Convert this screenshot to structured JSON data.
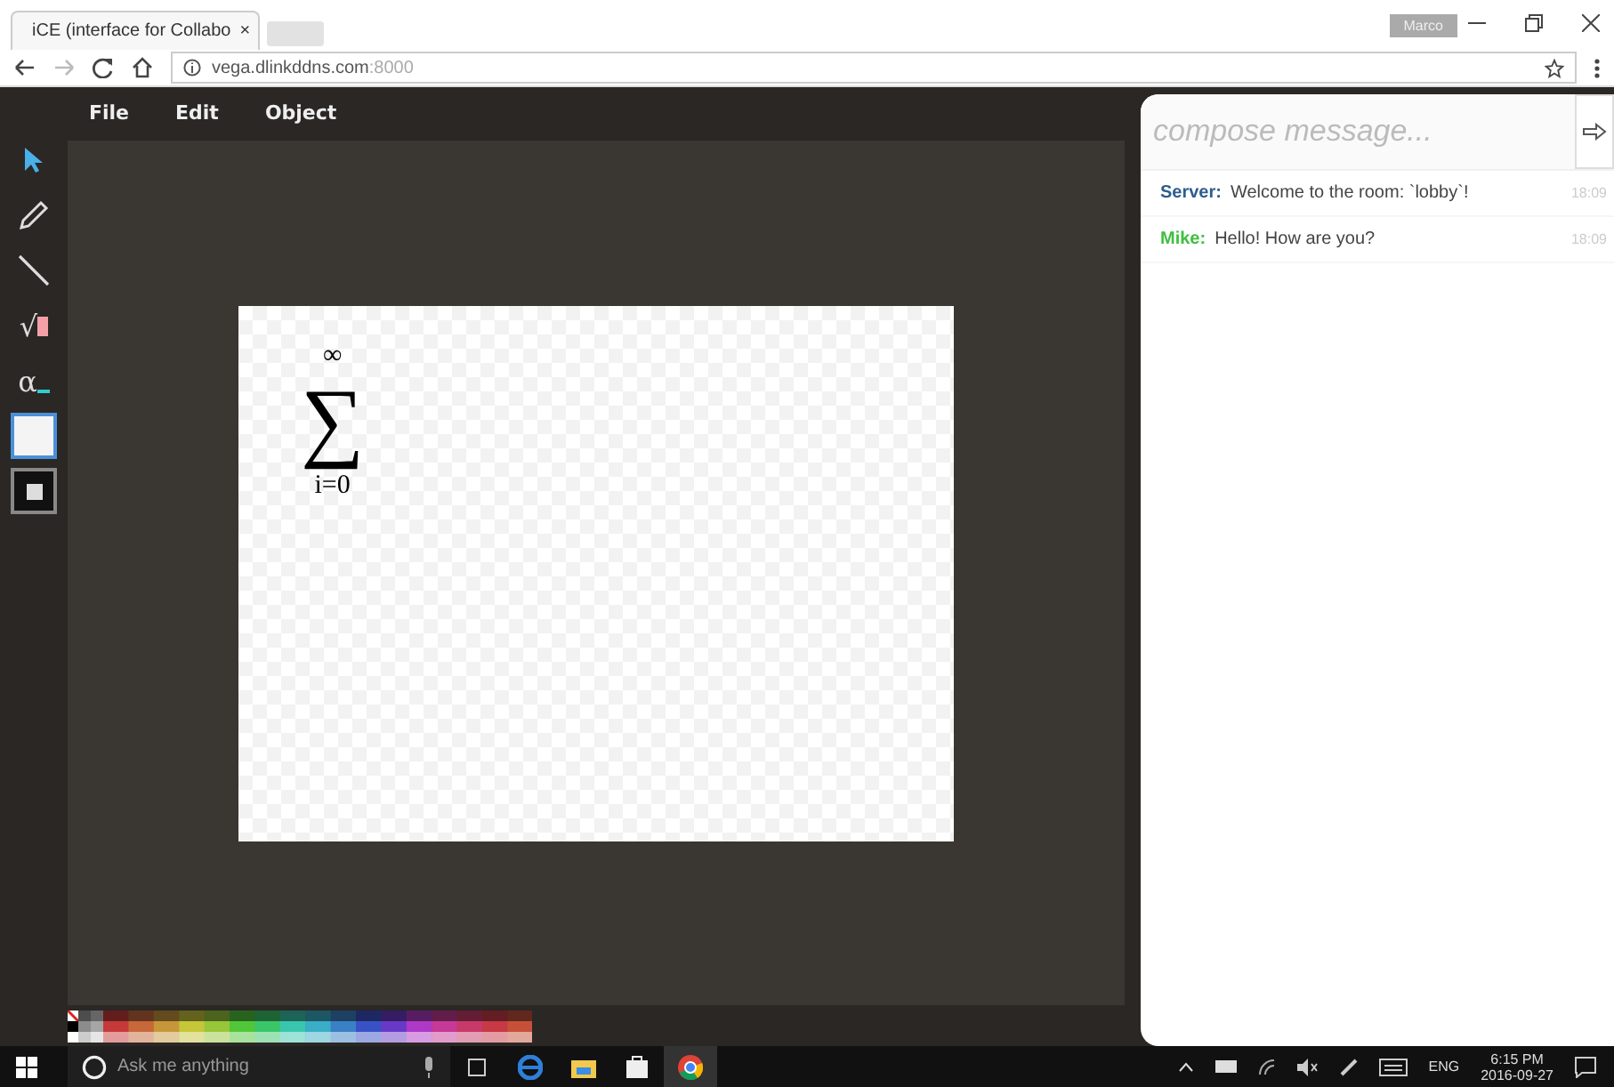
{
  "browser": {
    "tab_title": "iCE (interface for Collabo",
    "tab_close": "×",
    "host": "vega.dlinkddns.com",
    "port": ":8000",
    "profile": "Marco"
  },
  "menu": [
    "File",
    "Edit",
    "Object"
  ],
  "tools": [
    {
      "kind": "select",
      "selected": true
    },
    {
      "kind": "pencil",
      "selected": false
    },
    {
      "kind": "line",
      "selected": false
    },
    {
      "kind": "sqrt",
      "label": "√",
      "selected": false
    },
    {
      "kind": "alpha",
      "label": "α",
      "selected": false
    },
    {
      "kind": "fill",
      "selected": true
    },
    {
      "kind": "stroke",
      "selected": false
    }
  ],
  "canvas": {
    "upper": "∞",
    "symbol": "∑",
    "lower": "i=0"
  },
  "chat": {
    "placeholder": "compose message...",
    "messages": [
      {
        "sender": "Server:",
        "text": "Welcome to the room: `lobby`!",
        "time": "18:09",
        "color": "#2f5c8f"
      },
      {
        "sender": "Mike:",
        "text": "Hello! How are you?",
        "time": "18:09",
        "color": "#3fbf3f"
      }
    ]
  },
  "taskbar": {
    "search_placeholder": "Ask me anything",
    "language": "ENG",
    "time": "6:15 PM",
    "date": "2016-09-27"
  }
}
